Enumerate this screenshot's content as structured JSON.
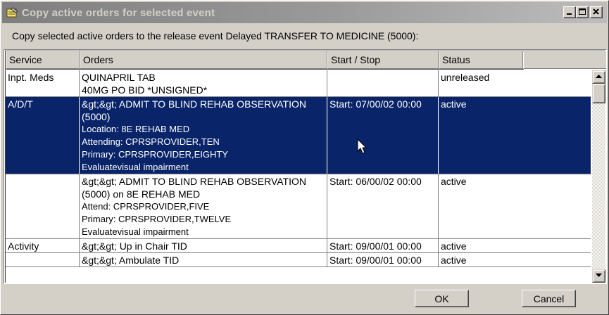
{
  "window": {
    "title": "Copy active orders for selected event",
    "buttons": {
      "minimize": "minimize-icon",
      "maximize": "maximize-icon",
      "close": "close-icon"
    }
  },
  "instruction": "Copy selected active orders to the release event Delayed TRANSFER TO MEDICINE (5000):",
  "grid": {
    "columns": [
      "Service",
      "Orders",
      "Start / Stop",
      "Status"
    ],
    "rows": [
      {
        "service": "Inpt. Meds",
        "order_lines": [
          "QUINAPRIL TAB",
          "40MG PO BID *UNSIGNED*"
        ],
        "start_stop": "",
        "status": "unreleased",
        "selected": false
      },
      {
        "service": "A/D/T",
        "order_lines": [
          "&gt;&gt; ADMIT TO BLIND REHAB OBSERVATION",
          "(5000)",
          "Location:   8E REHAB MED",
          "Attending:  CPRSPROVIDER,TEN",
          "Primary:    CPRSPROVIDER,EIGHTY",
          "Evaluatevisual impairment"
        ],
        "start_stop": "Start: 07/00/02 00:00",
        "status": "active",
        "selected": true
      },
      {
        "service": "",
        "order_lines": [
          "&gt;&gt; ADMIT TO BLIND REHAB OBSERVATION",
          "(5000) on 8E REHAB MED",
          "Attend:  CPRSPROVIDER,FIVE",
          "Primary:  CPRSPROVIDER,TWELVE",
          "Evaluatevisual impairment"
        ],
        "start_stop": "Start: 06/00/02 00:00",
        "status": "active",
        "selected": false
      },
      {
        "service": "Activity",
        "order_lines": [
          "&gt;&gt; Up in Chair TID"
        ],
        "start_stop": "Start: 09/00/01 00:00",
        "status": "active",
        "selected": false
      },
      {
        "service": "",
        "order_lines": [
          "&gt;&gt; Ambulate TID"
        ],
        "start_stop": "Start: 09/00/01 00:00",
        "status": "active",
        "selected": false
      }
    ]
  },
  "buttons": {
    "ok": "OK",
    "cancel": "Cancel"
  },
  "colors": {
    "selection": "#0a246a",
    "face": "#d4d0c8",
    "title_inactive": "#7f7f7f"
  }
}
